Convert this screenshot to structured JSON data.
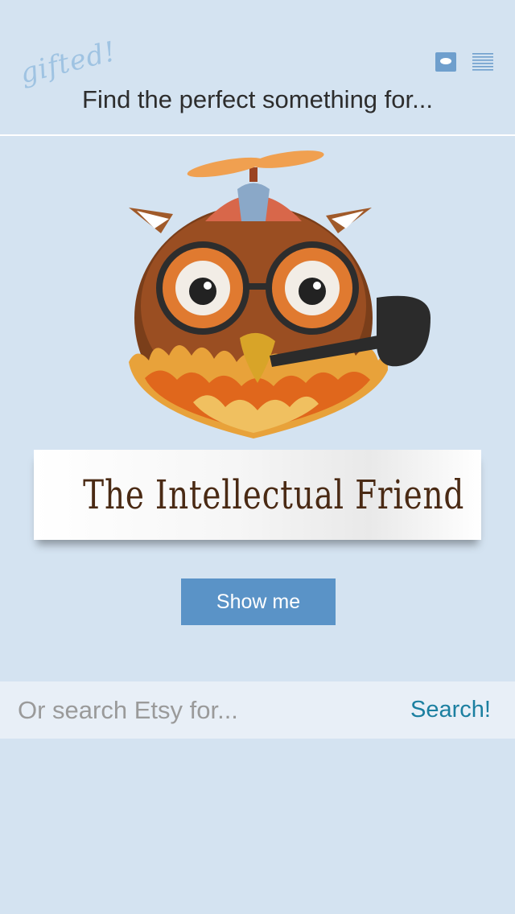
{
  "app": {
    "logo": "gifted!"
  },
  "header": {
    "tagline": "Find the perfect something for..."
  },
  "suggestion": {
    "title": "The Intellectual Friend",
    "button_label": "Show me"
  },
  "search": {
    "placeholder": "Or search Etsy for...",
    "button_label": "Search!"
  },
  "icons": {
    "chat": "chat-bubble-icon",
    "menu": "hamburger-menu-icon"
  },
  "colors": {
    "background": "#d4e3f1",
    "button": "#5a93c7",
    "search_link": "#1b7fa0",
    "banner_text": "#4a2a14"
  }
}
